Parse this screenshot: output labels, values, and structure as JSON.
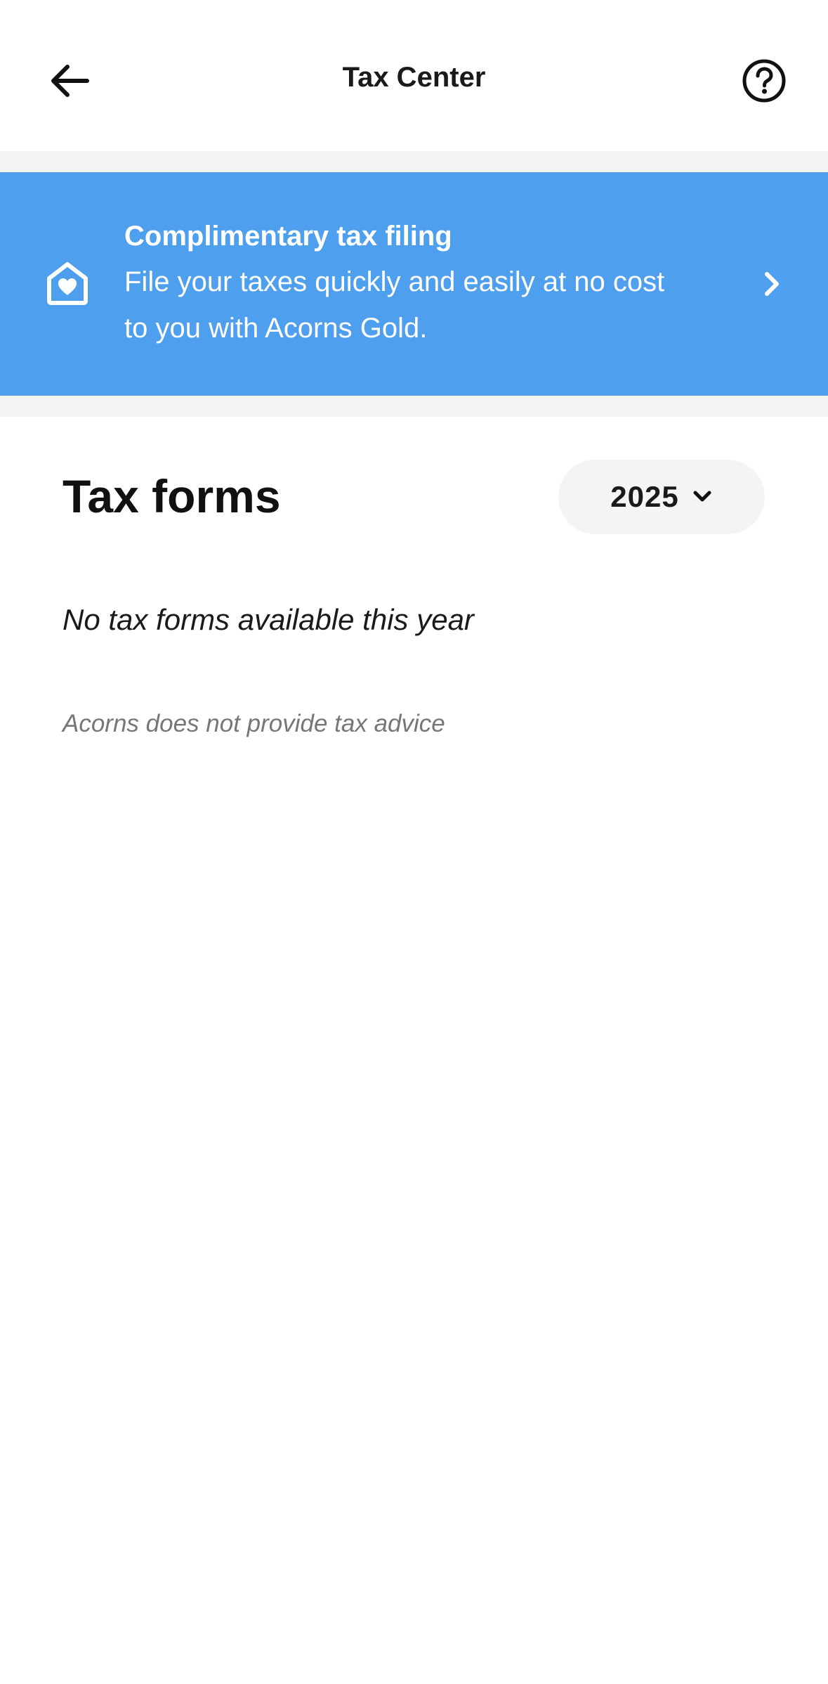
{
  "header": {
    "title": "Tax Center",
    "back_icon": "arrow-left-icon",
    "help_icon": "question-circle-icon"
  },
  "banner": {
    "title": "Complimentary tax filing",
    "body_line1": "File your taxes quickly and easily at no cost",
    "body_line2": "to you with Acorns Gold.",
    "icon": "house-heart-icon",
    "chevron_icon": "chevron-right-icon",
    "background_color": "#4e9fed"
  },
  "tax_forms": {
    "title": "Tax forms",
    "selected_year": "2025",
    "empty_message": "No tax forms available this year",
    "disclaimer": "Acorns does not provide tax advice"
  }
}
